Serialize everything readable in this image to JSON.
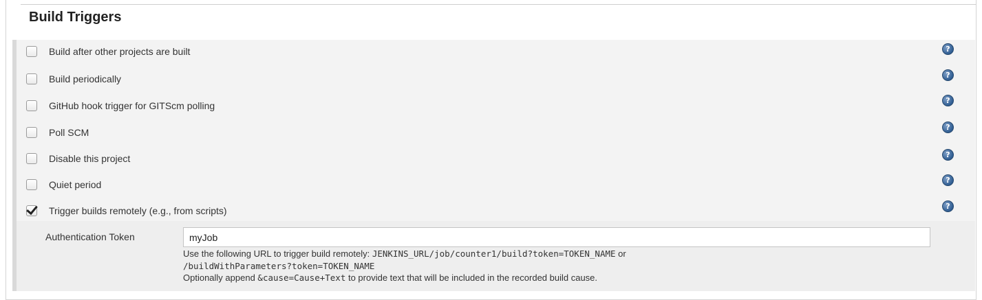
{
  "section": {
    "title": "Build Triggers"
  },
  "triggers": [
    {
      "label": "Build after other projects are built",
      "checked": false
    },
    {
      "label": "Build periodically",
      "checked": false
    },
    {
      "label": "GitHub hook trigger for GITScm polling",
      "checked": false
    },
    {
      "label": "Poll SCM",
      "checked": false
    },
    {
      "label": "Disable this project",
      "checked": false
    },
    {
      "label": "Quiet period",
      "checked": false
    },
    {
      "label": "Trigger builds remotely (e.g., from scripts)",
      "checked": true
    }
  ],
  "help_icon_glyph": "?",
  "auth": {
    "label": "Authentication Token",
    "value": "myJob",
    "help_line1_prefix": "Use the following URL to trigger build remotely: ",
    "help_line1_code": "JENKINS_URL/job/counter1/build?token=TOKEN_NAME",
    "help_line1_suffix": " or",
    "help_line2_code": "/buildWithParameters?token=TOKEN_NAME",
    "help_line3_prefix": "Optionally append ",
    "help_line3_code": "&cause=Cause+Text",
    "help_line3_suffix": " to provide text that will be included in the recorded build cause."
  },
  "colors": {
    "help_icon": "#2f5d92",
    "panel_bg": "#f3f3f3",
    "auth_bg": "#eeeeee"
  }
}
